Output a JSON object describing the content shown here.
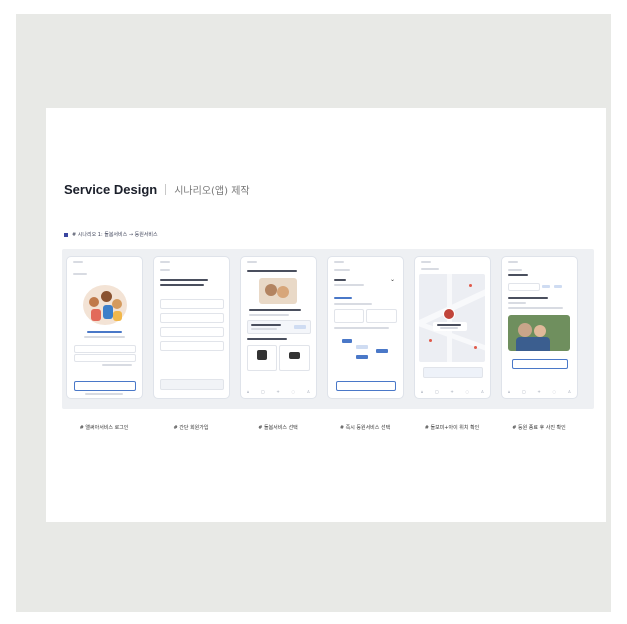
{
  "page": {
    "title_main": "Service Design",
    "title_sub": "시나리오(앱) 제작",
    "scenario_label": "# 시나리오 1: 돌봄서비스 → 등원서비스"
  },
  "screens": [
    {
      "caption": "# 앨써아서비스 로그인"
    },
    {
      "caption": "# 간단 회원가입"
    },
    {
      "caption": "# 돌봄서비스 선택"
    },
    {
      "caption": "# 즉시 등원서비스 선택"
    },
    {
      "caption": "# 돌보미+아이 위치 확인"
    },
    {
      "caption": "# 등원 종료 후 사진 확인"
    }
  ],
  "colors": {
    "frame_bg": "#e8e9e6",
    "accent_blue": "#4a78c8",
    "brand_navy": "#3a46a0"
  }
}
